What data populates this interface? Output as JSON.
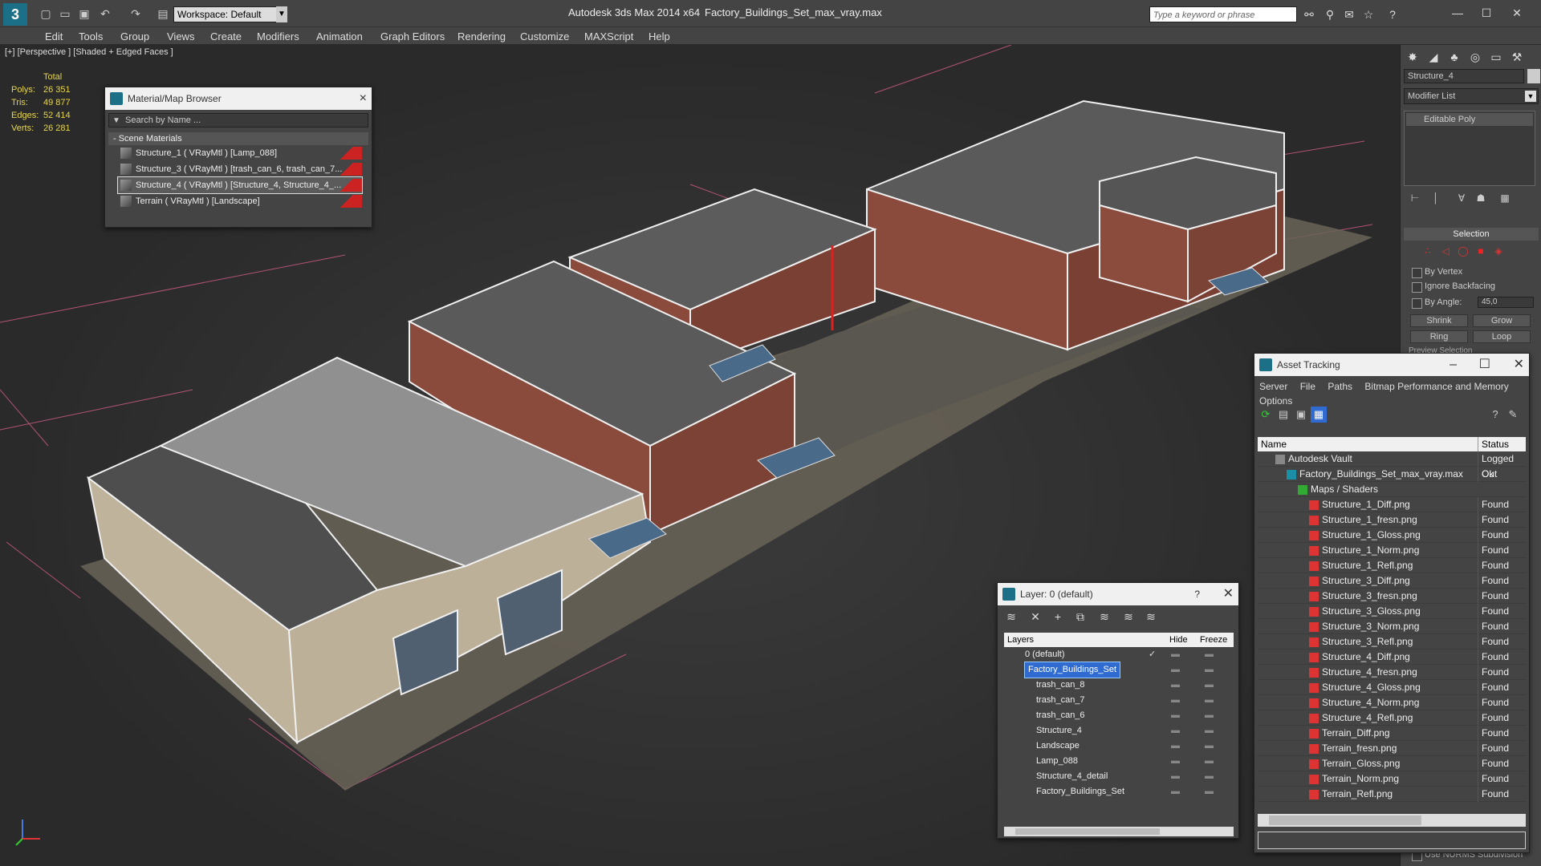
{
  "app": {
    "title": "Autodesk 3ds Max  2014 x64",
    "file": "Factory_Buildings_Set_max_vray.max",
    "workspace": "Workspace: Default",
    "search_placeholder": "Type a keyword or phrase"
  },
  "menu": [
    "Edit",
    "Tools",
    "Group",
    "Views",
    "Create",
    "Modifiers",
    "Animation",
    "Graph Editors",
    "Rendering",
    "Customize",
    "MAXScript",
    "Help"
  ],
  "viewport": {
    "label": "[+] [Perspective ] [Shaded + Edged Faces ]",
    "stats": {
      "total_label": "Total",
      "rows": [
        {
          "label": "Polys:",
          "value": "26 351"
        },
        {
          "label": "Tris:",
          "value": "49 877"
        },
        {
          "label": "Edges:",
          "value": "52 414"
        },
        {
          "label": "Verts:",
          "value": "26 281"
        }
      ]
    }
  },
  "material_browser": {
    "title": "Material/Map Browser",
    "search_placeholder": "Search by Name ...",
    "section": "- Scene Materials",
    "items": [
      {
        "label": "Structure_1  ( VRayMtl )  [Lamp_088]",
        "selected": false
      },
      {
        "label": "Structure_3  ( VRayMtl )  [trash_can_6, trash_can_7...",
        "selected": false
      },
      {
        "label": "Structure_4  ( VRayMtl )  [Structure_4, Structure_4_...",
        "selected": true
      },
      {
        "label": "Terrain  ( VRayMtl )  [Landscape]",
        "selected": false
      }
    ]
  },
  "command_panel": {
    "object_name": "Structure_4",
    "modifier_list": "Modifier List",
    "stack_item": "Editable Poly",
    "selection_header": "Selection",
    "by_vertex": "By Vertex",
    "ignore_backfacing": "Ignore Backfacing",
    "by_angle": "By Angle:",
    "by_angle_value": "45,0",
    "shrink": "Shrink",
    "grow": "Grow",
    "ring": "Ring",
    "loop": "Loop",
    "preview": "Preview Selection",
    "nurms": "Use NURMS Subdivision"
  },
  "asset_tracking": {
    "title": "Asset Tracking",
    "menu": [
      "Server",
      "File",
      "Paths",
      "Bitmap Performance and Memory",
      "Options"
    ],
    "col_name": "Name",
    "col_status": "Status",
    "rows": [
      {
        "name": "Autodesk Vault",
        "status": "Logged Out",
        "indent": 1,
        "icon": "vault"
      },
      {
        "name": "Factory_Buildings_Set_max_vray.max",
        "status": "Ok",
        "indent": 2,
        "icon": "max"
      },
      {
        "name": "Maps / Shaders",
        "status": "",
        "indent": 3,
        "icon": "maps"
      },
      {
        "name": "Structure_1_Diff.png",
        "status": "Found",
        "indent": 4,
        "icon": "png"
      },
      {
        "name": "Structure_1_fresn.png",
        "status": "Found",
        "indent": 4,
        "icon": "png"
      },
      {
        "name": "Structure_1_Gloss.png",
        "status": "Found",
        "indent": 4,
        "icon": "png"
      },
      {
        "name": "Structure_1_Norm.png",
        "status": "Found",
        "indent": 4,
        "icon": "png"
      },
      {
        "name": "Structure_1_Refl.png",
        "status": "Found",
        "indent": 4,
        "icon": "png"
      },
      {
        "name": "Structure_3_Diff.png",
        "status": "Found",
        "indent": 4,
        "icon": "png"
      },
      {
        "name": "Structure_3_fresn.png",
        "status": "Found",
        "indent": 4,
        "icon": "png"
      },
      {
        "name": "Structure_3_Gloss.png",
        "status": "Found",
        "indent": 4,
        "icon": "png"
      },
      {
        "name": "Structure_3_Norm.png",
        "status": "Found",
        "indent": 4,
        "icon": "png"
      },
      {
        "name": "Structure_3_Refl.png",
        "status": "Found",
        "indent": 4,
        "icon": "png"
      },
      {
        "name": "Structure_4_Diff.png",
        "status": "Found",
        "indent": 4,
        "icon": "png"
      },
      {
        "name": "Structure_4_fresn.png",
        "status": "Found",
        "indent": 4,
        "icon": "png"
      },
      {
        "name": "Structure_4_Gloss.png",
        "status": "Found",
        "indent": 4,
        "icon": "png"
      },
      {
        "name": "Structure_4_Norm.png",
        "status": "Found",
        "indent": 4,
        "icon": "png"
      },
      {
        "name": "Structure_4_Refl.png",
        "status": "Found",
        "indent": 4,
        "icon": "png"
      },
      {
        "name": "Terrain_Diff.png",
        "status": "Found",
        "indent": 4,
        "icon": "png"
      },
      {
        "name": "Terrain_fresn.png",
        "status": "Found",
        "indent": 4,
        "icon": "png"
      },
      {
        "name": "Terrain_Gloss.png",
        "status": "Found",
        "indent": 4,
        "icon": "png"
      },
      {
        "name": "Terrain_Norm.png",
        "status": "Found",
        "indent": 4,
        "icon": "png"
      },
      {
        "name": "Terrain_Refl.png",
        "status": "Found",
        "indent": 4,
        "icon": "png"
      }
    ]
  },
  "layers": {
    "title": "Layer: 0 (default)",
    "help": "?",
    "col_layers": "Layers",
    "col_hide": "Hide",
    "col_freeze": "Freeze",
    "rows": [
      {
        "name": "0 (default)",
        "level": 0,
        "selected": false,
        "current": true
      },
      {
        "name": "Factory_Buildings_Set",
        "level": 0,
        "selected": true,
        "current": false
      },
      {
        "name": "trash_can_8",
        "level": 1,
        "selected": false,
        "current": false
      },
      {
        "name": "trash_can_7",
        "level": 1,
        "selected": false,
        "current": false
      },
      {
        "name": "trash_can_6",
        "level": 1,
        "selected": false,
        "current": false
      },
      {
        "name": "Structure_4",
        "level": 1,
        "selected": false,
        "current": false
      },
      {
        "name": "Landscape",
        "level": 1,
        "selected": false,
        "current": false
      },
      {
        "name": "Lamp_088",
        "level": 1,
        "selected": false,
        "current": false
      },
      {
        "name": "Structure_4_detail",
        "level": 1,
        "selected": false,
        "current": false
      },
      {
        "name": "Factory_Buildings_Set",
        "level": 1,
        "selected": false,
        "current": false
      }
    ]
  },
  "colors": {
    "selection": "#2f6bd0",
    "accent": "#1b6f86",
    "stats": "#e8d64a"
  }
}
